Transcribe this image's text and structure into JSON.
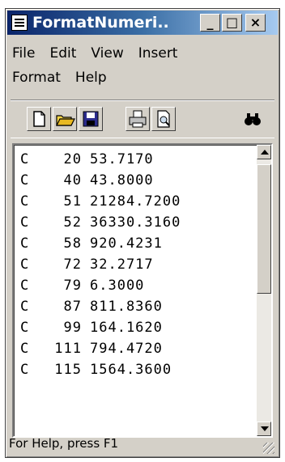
{
  "window": {
    "title": "FormatNumeri..."
  },
  "window_buttons": {
    "minimize": "_",
    "maximize": "□",
    "close": "×"
  },
  "menu": {
    "row1": [
      "File",
      "Edit",
      "View",
      "Insert"
    ],
    "row2": [
      "Format",
      "Help"
    ]
  },
  "toolbar": {
    "icons": [
      "new-document-icon",
      "open-folder-icon",
      "save-disk-icon",
      "print-icon",
      "print-preview-icon",
      "find-binoculars-icon"
    ]
  },
  "document": {
    "lines": [
      [
        "C",
        "20",
        "53.7170"
      ],
      [
        "C",
        "40",
        "43.8000"
      ],
      [
        "C",
        "51",
        "21284.7200"
      ],
      [
        "C",
        "52",
        "36330.3160"
      ],
      [
        "C",
        "58",
        "920.4231"
      ],
      [
        "C",
        "72",
        "32.2717"
      ],
      [
        "C",
        "79",
        "6.3000"
      ],
      [
        "C",
        "87",
        "811.8360"
      ],
      [
        "C",
        "99",
        "164.1620"
      ],
      [
        "C",
        "111",
        "794.4720"
      ],
      [
        "C",
        "115",
        "1564.3600"
      ]
    ]
  },
  "status": {
    "text": "For Help, press F1"
  }
}
